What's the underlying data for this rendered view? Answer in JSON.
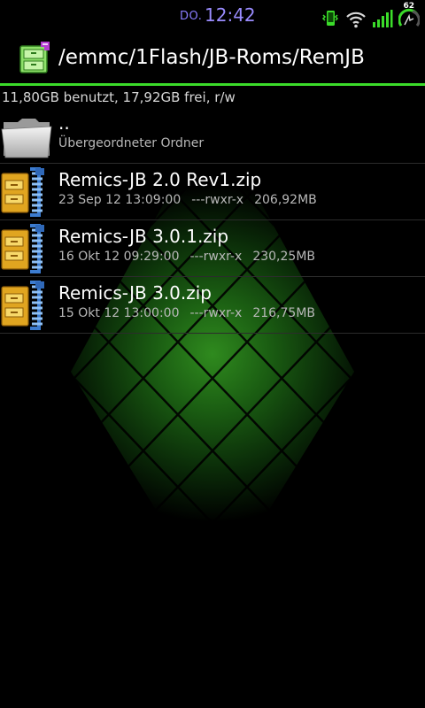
{
  "status_bar": {
    "day": "DO.",
    "time": "12:42",
    "battery_level": "62",
    "icons": [
      "phone-vibrate-icon",
      "wifi-icon",
      "signal-icon",
      "battery-icon"
    ]
  },
  "title_bar": {
    "path": "/emmc/1Flash/JB-Roms/RemJB",
    "app_icon": "file-cabinet-icon"
  },
  "storage": {
    "text": "11,80GB benutzt, 17,92GB frei, r/w"
  },
  "files": [
    {
      "icon": "folder-icon",
      "name": "..",
      "subtitle": "Übergeordneter Ordner"
    },
    {
      "icon": "zip-archive-icon",
      "name": "Remics-JB 2.0 Rev1.zip",
      "date": "23 Sep 12 13:09:00",
      "perms": "---rwxr-x",
      "size": "206,92MB"
    },
    {
      "icon": "zip-archive-icon",
      "name": "Remics-JB 3.0.1.zip",
      "date": "16 Okt 12 09:29:00",
      "perms": "---rwxr-x",
      "size": "230,25MB"
    },
    {
      "icon": "zip-archive-icon",
      "name": "Remics-JB 3.0.zip",
      "date": "15 Okt 12 13:00:00",
      "perms": "---rwxr-x",
      "size": "216,75MB"
    }
  ],
  "colors": {
    "accent": "#3bdc2a",
    "clock": "#9a8cff",
    "background": "#000000"
  }
}
